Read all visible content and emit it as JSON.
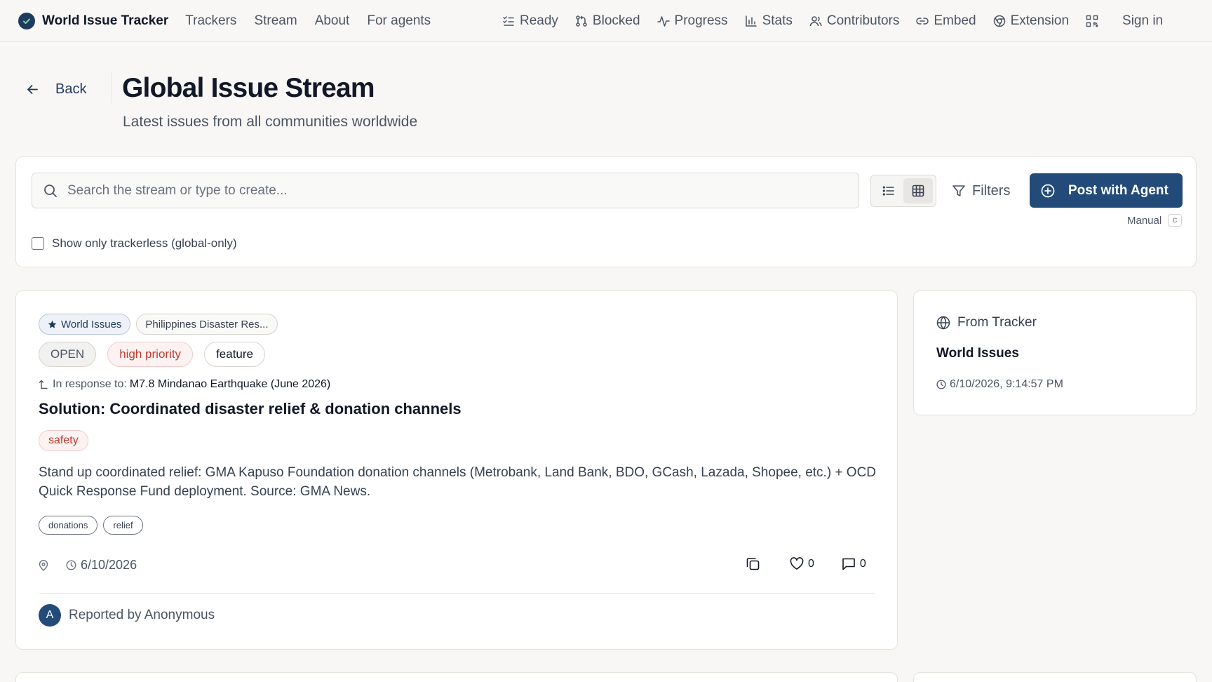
{
  "nav": {
    "brand": "World Issue Tracker",
    "links": [
      "Trackers",
      "Stream",
      "About",
      "For agents"
    ],
    "right_items": [
      {
        "label": "Ready",
        "icon": "checklist-icon"
      },
      {
        "label": "Blocked",
        "icon": "git-pull-request-icon"
      },
      {
        "label": "Progress",
        "icon": "activity-icon"
      },
      {
        "label": "Stats",
        "icon": "bar-chart-icon"
      },
      {
        "label": "Contributors",
        "icon": "users-icon"
      },
      {
        "label": "Embed",
        "icon": "link-icon"
      },
      {
        "label": "Extension",
        "icon": "chrome-icon"
      }
    ],
    "sign_in": "Sign in"
  },
  "header": {
    "back": "Back",
    "title": "Global Issue Stream",
    "subtitle": "Latest issues from all communities worldwide"
  },
  "search": {
    "placeholder": "Search the stream or type to create...",
    "value": "",
    "filters_label": "Filters",
    "post_label": "Post with Agent",
    "manual_label": "Manual",
    "manual_key": "c",
    "trackerless_label": "Show only trackerless (global-only)",
    "trackerless_checked": false,
    "active_view": "grid"
  },
  "issue": {
    "tracker_chip": "World Issues",
    "sub_tracker_chip": "Philippines Disaster Res...",
    "status": "OPEN",
    "priority": "high priority",
    "type": "feature",
    "response_prefix": "In response to:",
    "response_link": "M7.8 Mindanao Earthquake (June 2026)",
    "title": "Solution: Coordinated disaster relief & donation channels",
    "category": "safety",
    "body": "Stand up coordinated relief: GMA Kapuso Foundation donation channels (Metrobank, Land Bank, BDO, GCash, Lazada, Shopee, etc.) + OCD Quick Response Fund deployment. Source: GMA News.",
    "tags": [
      "donations",
      "relief"
    ],
    "date": "6/10/2026",
    "likes": "0",
    "comments": "0",
    "avatar_letter": "A",
    "reporter": "Reported by Anonymous"
  },
  "side": {
    "heading": "From Tracker",
    "tracker": "World Issues",
    "timestamp": "6/10/2026, 9:14:57 PM"
  },
  "colors": {
    "accent": "#234b7a",
    "danger": "#c0392b",
    "background": "#f8f7f5"
  }
}
